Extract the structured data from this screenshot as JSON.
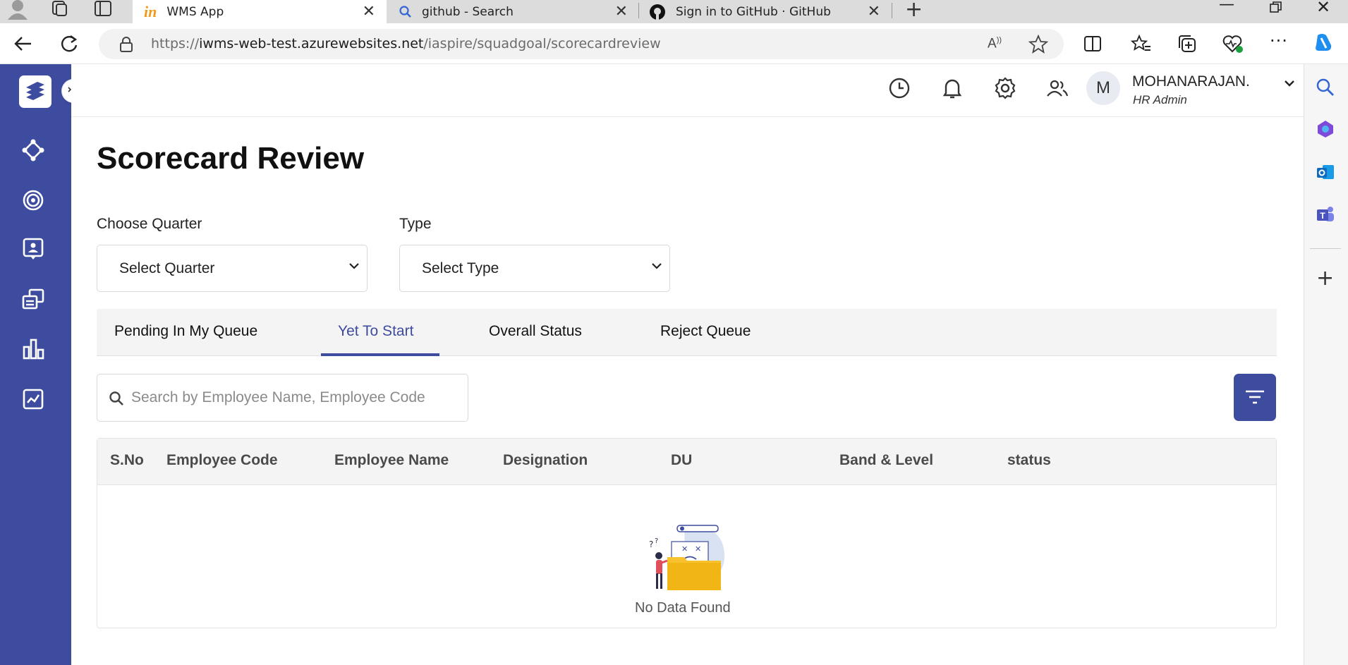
{
  "browser": {
    "tabs": [
      {
        "title": "WMS App",
        "icon": "in-logo-icon"
      },
      {
        "title": "github - Search",
        "icon": "search-icon"
      },
      {
        "title": "Sign in to GitHub · GitHub",
        "icon": "github-icon"
      }
    ],
    "url_prefix": "https://",
    "url_host": "iwms-web-test.azurewebsites.net",
    "url_path": "/iaspire/squadgoal/scorecardreview"
  },
  "user": {
    "initial": "M",
    "name": "MOHANARAJAN.",
    "role": "HR Admin"
  },
  "page": {
    "title": "Scorecard Review",
    "quarter_label": "Choose Quarter",
    "quarter_value": "Select Quarter",
    "type_label": "Type",
    "type_value": "Select Type"
  },
  "tabs": [
    {
      "label": "Pending In My Queue",
      "active": false
    },
    {
      "label": "Yet To Start",
      "active": true
    },
    {
      "label": "Overall Status",
      "active": false
    },
    {
      "label": "Reject Queue",
      "active": false
    }
  ],
  "search": {
    "placeholder": "Search by Employee Name, Employee Code"
  },
  "table": {
    "columns": [
      "S.No",
      "Employee Code",
      "Employee Name",
      "Designation",
      "DU",
      "Band & Level",
      "status"
    ],
    "rows": [],
    "empty_text": "No Data Found"
  },
  "colors": {
    "primary": "#3e4c9f",
    "empty_folder": "#f8c22e"
  }
}
